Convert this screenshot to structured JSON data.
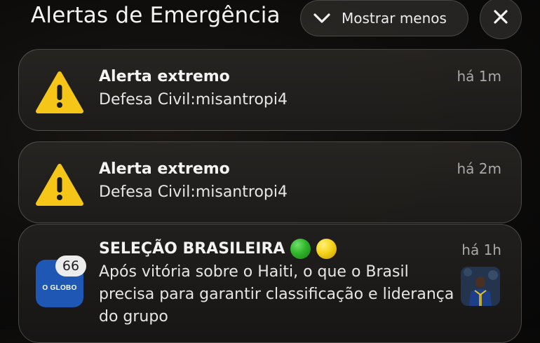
{
  "header": {
    "title": "Alertas de Emergência",
    "show_less_label": "Mostrar menos",
    "show_less_icon": "chevron-down-icon",
    "close_icon": "close-icon"
  },
  "notifications": [
    {
      "type": "alert",
      "icon": "warning-icon",
      "title": "Alerta extremo",
      "body": "Defesa Civil:misantropi4",
      "time": "há 1m"
    },
    {
      "type": "alert",
      "icon": "warning-icon",
      "title": "Alerta extremo",
      "body": "Defesa Civil:misantropi4",
      "time": "há 2m"
    },
    {
      "type": "news",
      "app_icon_text": "O GLOBO",
      "badge_count": "66",
      "title": "SELEÇÃO BRASILEIRA",
      "title_emoji": [
        "green-circle",
        "yellow-circle"
      ],
      "body": "Após vitória sobre o Haiti, o que o Brasil precisa para garantir classificação e liderança do grupo",
      "time": "há 1h",
      "thumbnail": "player-photo"
    }
  ],
  "colors": {
    "warning_yellow": "#F5C518",
    "app_icon_blue": "#1F57B5",
    "emoji_green": "#2FB52A",
    "emoji_yellow": "#F6D21A"
  }
}
